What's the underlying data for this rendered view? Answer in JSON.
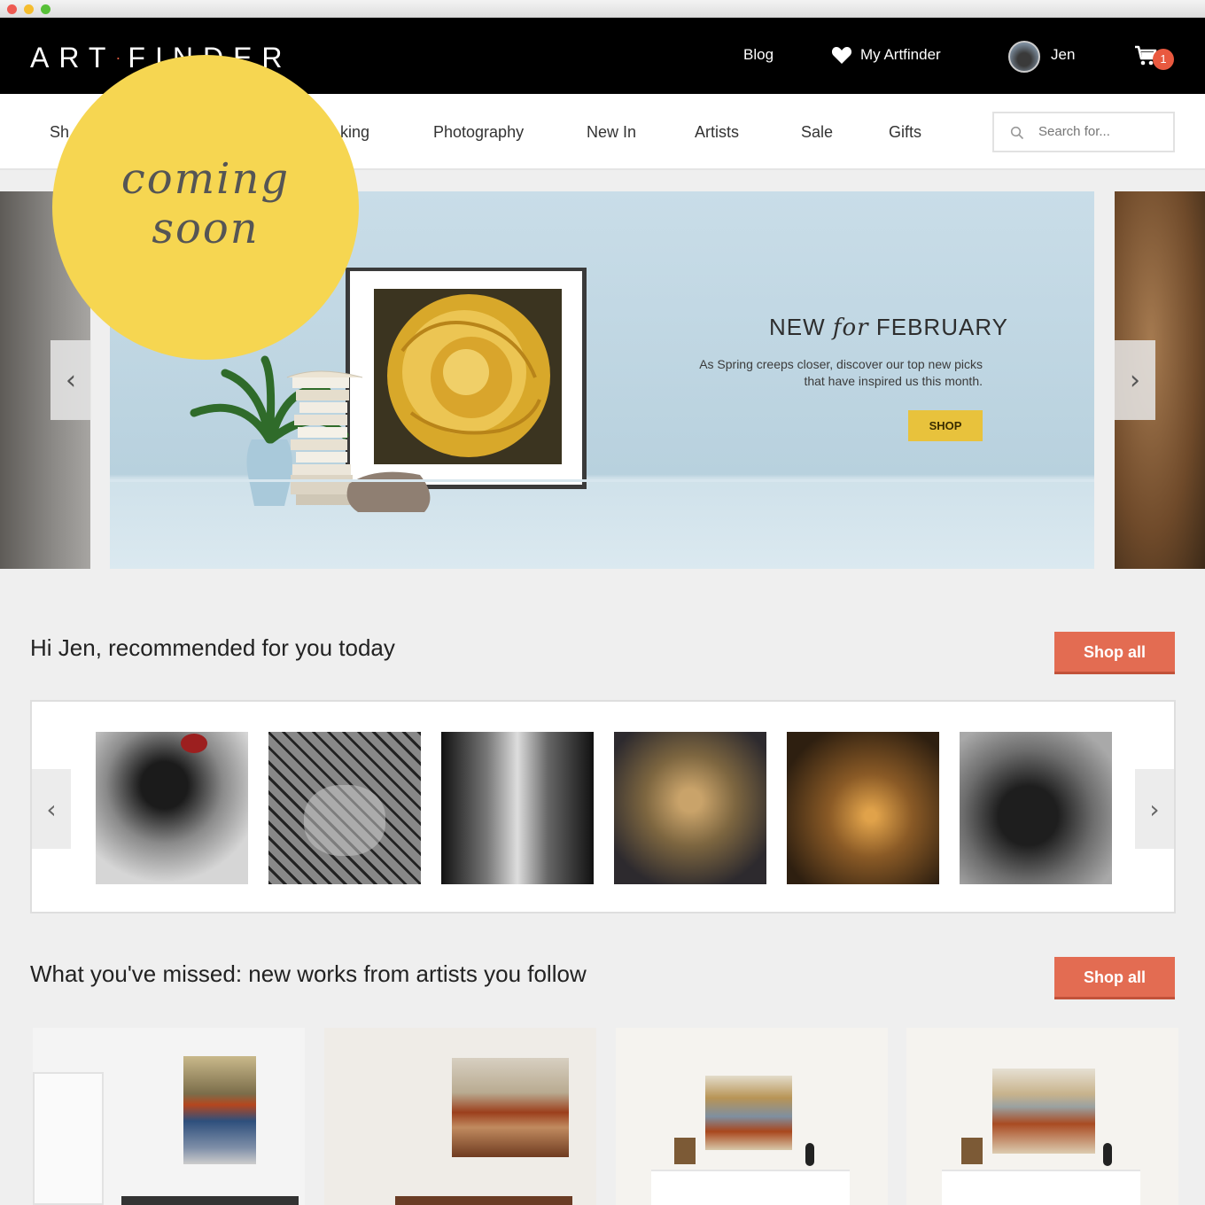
{
  "window": {
    "controls": [
      "close",
      "minimize",
      "maximize"
    ]
  },
  "header": {
    "logo_left": "ART",
    "logo_dot": "·",
    "logo_right": "FINDER",
    "blog": "Blog",
    "my_artfinder": "My Artfinder",
    "user_name": "Jen",
    "cart_count": "1"
  },
  "nav": {
    "items": [
      "Sh",
      "king",
      "Photography",
      "New In",
      "Artists",
      "Sale",
      "Gifts"
    ],
    "search_placeholder": "Search for..."
  },
  "badge": {
    "line1": "coming",
    "line2": "soon"
  },
  "hero": {
    "title_a": "NEW",
    "title_b": "for",
    "title_c": "FEBRUARY",
    "text": "As Spring creeps closer, discover our top new picks that have inspired us this month.",
    "button": "SHOP"
  },
  "recommended": {
    "title": "Hi Jen, recommended for you today",
    "shop_all": "Shop all"
  },
  "missed": {
    "title": "What you've missed: new works from artists you follow",
    "shop_all": "Shop all"
  },
  "colors": {
    "accent": "#e36c52",
    "badge": "#f6d651",
    "shop_button": "#e8c23c"
  }
}
